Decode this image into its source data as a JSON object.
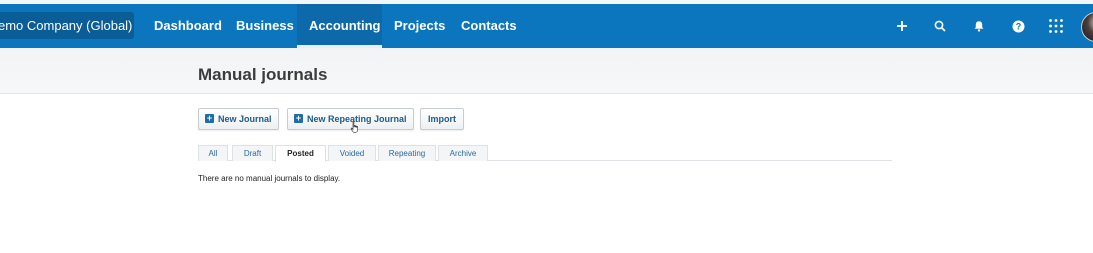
{
  "nav": {
    "org_label": "emo Company (Global)",
    "items": [
      {
        "label": "Dashboard"
      },
      {
        "label": "Business"
      },
      {
        "label": "Accounting"
      },
      {
        "label": "Projects"
      },
      {
        "label": "Contacts"
      }
    ],
    "active": "Accounting",
    "icons": [
      "plus-icon",
      "search-icon",
      "bell-icon",
      "help-icon",
      "apps-grid-icon",
      "avatar"
    ]
  },
  "page": {
    "title": "Manual journals"
  },
  "actions": {
    "new_journal": "New Journal",
    "new_repeating_journal": "New Repeating Journal",
    "import": "Import"
  },
  "tabs": [
    {
      "label": "All"
    },
    {
      "label": "Draft"
    },
    {
      "label": "Posted"
    },
    {
      "label": "Voided"
    },
    {
      "label": "Repeating"
    },
    {
      "label": "Archive"
    }
  ],
  "active_tab": "Posted",
  "empty_message": "There are no manual journals to display.",
  "colors": {
    "navbar": "#0b75be",
    "org_switch": "#0a5d97",
    "link": "#2a6aa5"
  }
}
